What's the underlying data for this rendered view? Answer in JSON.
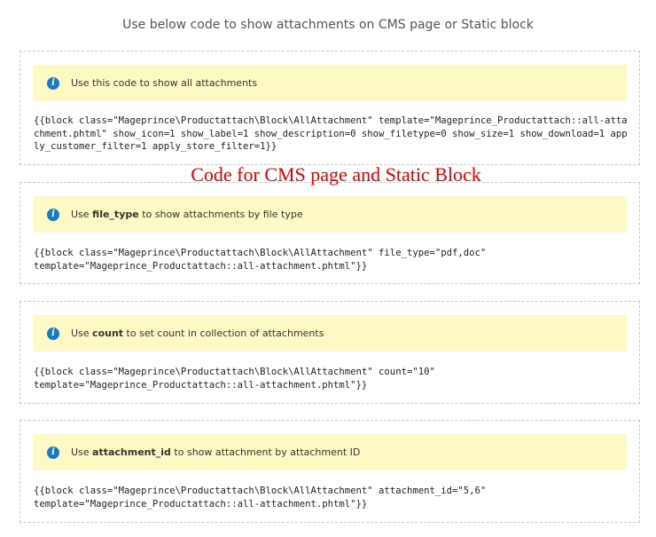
{
  "page_title": "Use below code to show attachments on CMS page or Static block",
  "overlay_caption": "Code for CMS page and Static Block",
  "colors": {
    "notice_bg": "#fdf9c4",
    "info_icon": "#1979c3",
    "caption_red": "#e00000"
  },
  "icons": {
    "info": "info-icon"
  },
  "sections": [
    {
      "notice_prefix": "Use this code to show all attachments",
      "notice_bold": "",
      "notice_suffix": "",
      "code": "{{block class=\"Mageprince\\Productattach\\Block\\AllAttachment\" template=\"Mageprince_Productattach::all-attachment.phtml\" show_icon=1 show_label=1 show_description=0 show_filetype=0 show_size=1 show_download=1 apply_customer_filter=1 apply_store_filter=1}}"
    },
    {
      "notice_prefix": "Use ",
      "notice_bold": "file_type",
      "notice_suffix": " to show attachments by file type",
      "code": "{{block class=\"Mageprince\\Productattach\\Block\\AllAttachment\" file_type=\"pdf,doc\"\ntemplate=\"Mageprince_Productattach::all-attachment.phtml\"}}"
    },
    {
      "notice_prefix": "Use ",
      "notice_bold": "count",
      "notice_suffix": " to set count in collection of attachments",
      "code": "{{block class=\"Mageprince\\Productattach\\Block\\AllAttachment\" count=\"10\"\ntemplate=\"Mageprince_Productattach::all-attachment.phtml\"}}"
    },
    {
      "notice_prefix": "Use ",
      "notice_bold": "attachment_id",
      "notice_suffix": " to show attachment by attachment ID",
      "code": "{{block class=\"Mageprince\\Productattach\\Block\\AllAttachment\" attachment_id=\"5,6\"\ntemplate=\"Mageprince_Productattach::all-attachment.phtml\"}}"
    }
  ]
}
